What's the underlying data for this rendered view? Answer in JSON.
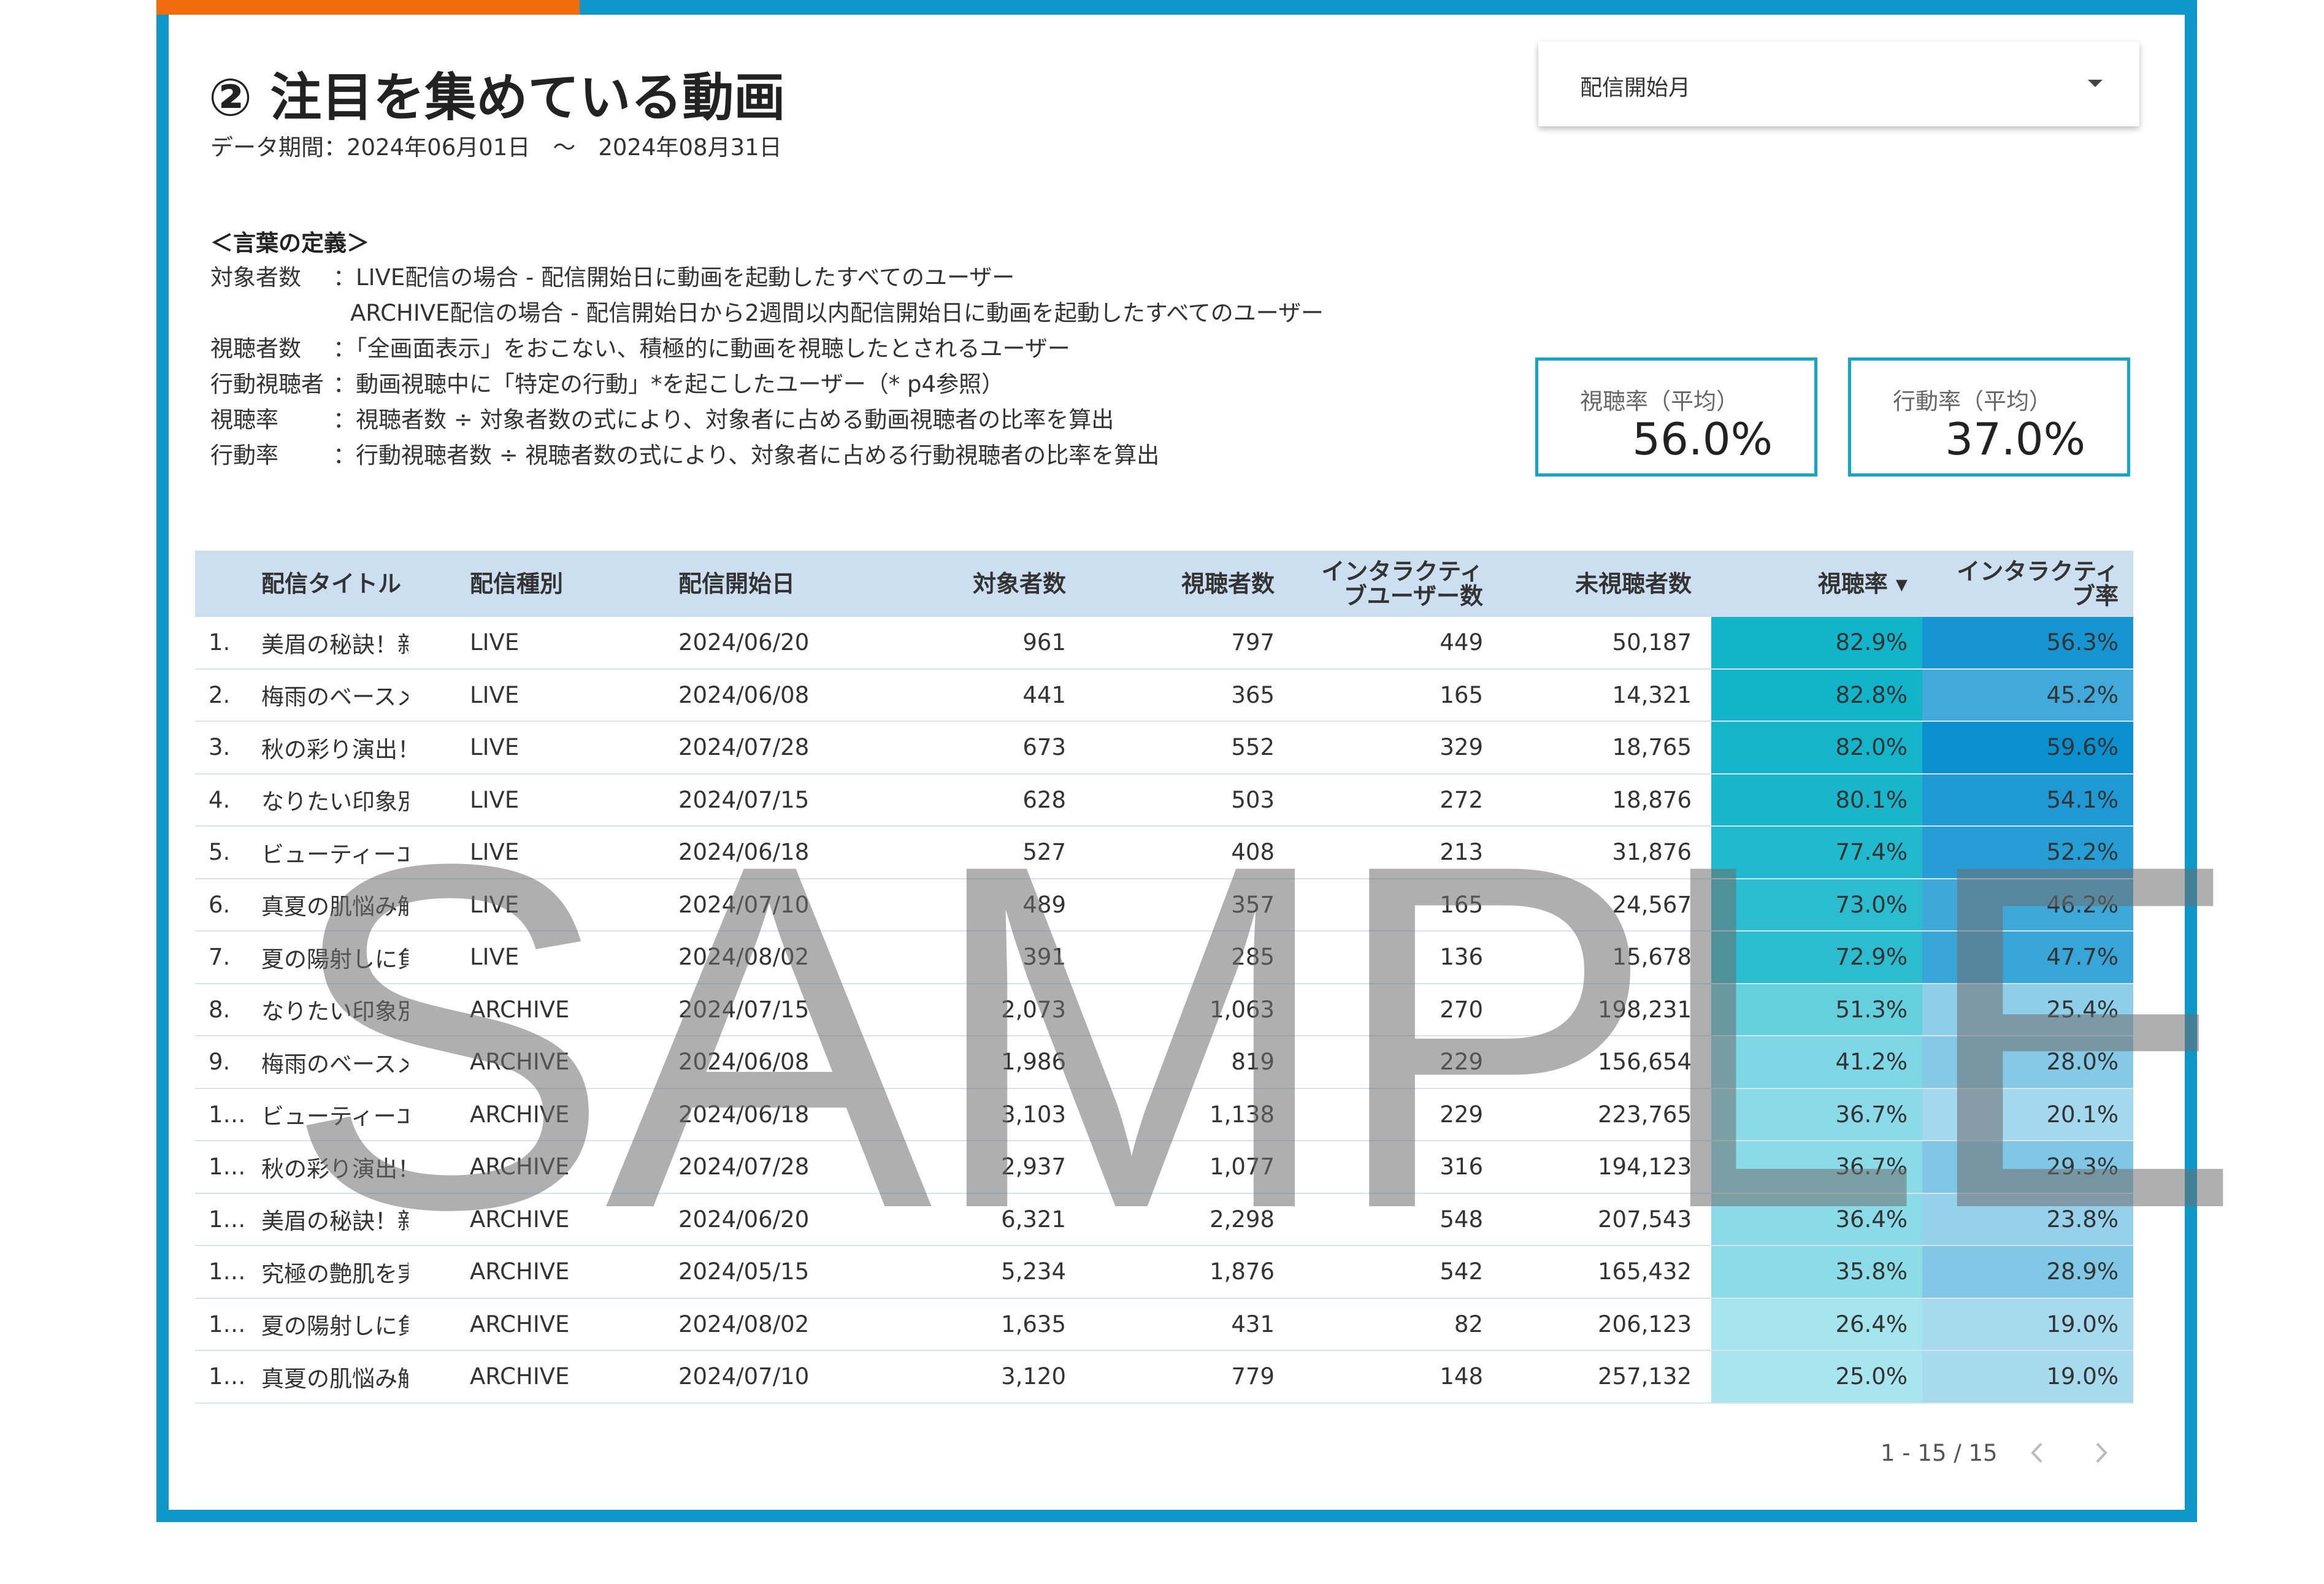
{
  "page": {
    "title": "② 注目を集めている動画",
    "period": "データ期間：2024年06月01日　～　2024年08月31日"
  },
  "filter": {
    "label": "配信開始月"
  },
  "definitions": {
    "heading": "＜言葉の定義＞",
    "rows": [
      {
        "term": "対象者数",
        "text": "：LIVE配信の場合 - 配信開始日に動画を起動したすべてのユーザー"
      },
      {
        "term": "",
        "text": "ARCHIVE配信の場合 - 配信開始日から2週間以内配信開始日に動画を起動したすべてのユーザー"
      },
      {
        "term": "視聴者数",
        "text": "：「全画面表示」をおこない、積極的に動画を視聴したとされるユーザー"
      },
      {
        "term": "行動視聴者",
        "text": "：動画視聴中に「特定の行動」*を起こしたユーザー（* p4参照）"
      },
      {
        "term": "視聴率",
        "text": "：視聴者数 ÷ 対象者数の式により、対象者に占める動画視聴者の比率を算出"
      },
      {
        "term": "行動率",
        "text": "：行動視聴者数 ÷ 視聴者数の式により、対象者に占める行動視聴者の比率を算出"
      }
    ]
  },
  "kpis": [
    {
      "label": "視聴率（平均）",
      "value": "56.0%"
    },
    {
      "label": "行動率（平均）",
      "value": "37.0%"
    }
  ],
  "table": {
    "columns": [
      "配信タイトル",
      "配信種別",
      "配信開始日",
      "対象者数",
      "視聴者数",
      "インタラクティ\nブユーザー数",
      "未視聴者数",
      "視聴率 ▾",
      "インタラクティ\nブ率"
    ],
    "rows": [
      {
        "idx": "1.",
        "title": "美眉の秘訣！新…",
        "type": "LIVE",
        "date": "2024/06/20",
        "target": "961",
        "viewers": "797",
        "interactive": "449",
        "unviewed": "50,187",
        "view_rate": "82.9%",
        "inter_rate": "56.3%"
      },
      {
        "idx": "2.",
        "title": "梅雨のベースメ…",
        "type": "LIVE",
        "date": "2024/06/08",
        "target": "441",
        "viewers": "365",
        "interactive": "165",
        "unviewed": "14,321",
        "view_rate": "82.8%",
        "inter_rate": "45.2%"
      },
      {
        "idx": "3.",
        "title": "秋の彩り演出！…",
        "type": "LIVE",
        "date": "2024/07/28",
        "target": "673",
        "viewers": "552",
        "interactive": "329",
        "unviewed": "18,765",
        "view_rate": "82.0%",
        "inter_rate": "59.6%"
      },
      {
        "idx": "4.",
        "title": "なりたい印象別…",
        "type": "LIVE",
        "date": "2024/07/15",
        "target": "628",
        "viewers": "503",
        "interactive": "272",
        "unviewed": "18,876",
        "view_rate": "80.1%",
        "inter_rate": "54.1%"
      },
      {
        "idx": "5.",
        "title": "ビューティーエ…",
        "type": "LIVE",
        "date": "2024/06/18",
        "target": "527",
        "viewers": "408",
        "interactive": "213",
        "unviewed": "31,876",
        "view_rate": "77.4%",
        "inter_rate": "52.2%"
      },
      {
        "idx": "6.",
        "title": "真夏の肌悩み解…",
        "type": "LIVE",
        "date": "2024/07/10",
        "target": "489",
        "viewers": "357",
        "interactive": "165",
        "unviewed": "24,567",
        "view_rate": "73.0%",
        "inter_rate": "46.2%"
      },
      {
        "idx": "7.",
        "title": "夏の陽射しに負…",
        "type": "LIVE",
        "date": "2024/08/02",
        "target": "391",
        "viewers": "285",
        "interactive": "136",
        "unviewed": "15,678",
        "view_rate": "72.9%",
        "inter_rate": "47.7%"
      },
      {
        "idx": "8.",
        "title": "なりたい印象別…",
        "type": "ARCHIVE",
        "date": "2024/07/15",
        "target": "2,073",
        "viewers": "1,063",
        "interactive": "270",
        "unviewed": "198,231",
        "view_rate": "51.3%",
        "inter_rate": "25.4%"
      },
      {
        "idx": "9.",
        "title": "梅雨のベースメ…",
        "type": "ARCHIVE",
        "date": "2024/06/08",
        "target": "1,986",
        "viewers": "819",
        "interactive": "229",
        "unviewed": "156,654",
        "view_rate": "41.2%",
        "inter_rate": "28.0%"
      },
      {
        "idx": "1…",
        "title": "ビューティーエ…",
        "type": "ARCHIVE",
        "date": "2024/06/18",
        "target": "3,103",
        "viewers": "1,138",
        "interactive": "229",
        "unviewed": "223,765",
        "view_rate": "36.7%",
        "inter_rate": "20.1%"
      },
      {
        "idx": "1…",
        "title": "秋の彩り演出！…",
        "type": "ARCHIVE",
        "date": "2024/07/28",
        "target": "2,937",
        "viewers": "1,077",
        "interactive": "316",
        "unviewed": "194,123",
        "view_rate": "36.7%",
        "inter_rate": "29.3%"
      },
      {
        "idx": "1…",
        "title": "美眉の秘訣！新…",
        "type": "ARCHIVE",
        "date": "2024/06/20",
        "target": "6,321",
        "viewers": "2,298",
        "interactive": "548",
        "unviewed": "207,543",
        "view_rate": "36.4%",
        "inter_rate": "23.8%"
      },
      {
        "idx": "1…",
        "title": "究極の艶肌を実…",
        "type": "ARCHIVE",
        "date": "2024/05/15",
        "target": "5,234",
        "viewers": "1,876",
        "interactive": "542",
        "unviewed": "165,432",
        "view_rate": "35.8%",
        "inter_rate": "28.9%"
      },
      {
        "idx": "1…",
        "title": "夏の陽射しに負…",
        "type": "ARCHIVE",
        "date": "2024/08/02",
        "target": "1,635",
        "viewers": "431",
        "interactive": "82",
        "unviewed": "206,123",
        "view_rate": "26.4%",
        "inter_rate": "19.0%"
      },
      {
        "idx": "1…",
        "title": "真夏の肌悩み解…",
        "type": "ARCHIVE",
        "date": "2024/07/10",
        "target": "3,120",
        "viewers": "779",
        "interactive": "148",
        "unviewed": "257,132",
        "view_rate": "25.0%",
        "inter_rate": "19.0%"
      }
    ]
  },
  "pagination": {
    "text": "1 - 15 / 15"
  },
  "watermark": "SAMPLE",
  "colors": {
    "frame": "#0e97c9",
    "accent": "#f26b0c",
    "header_bg": "#cbdff1",
    "kpi_border": "#14a5c7",
    "view_rate_heat": "#12b4c9",
    "inter_rate_heat": "#0a8fcf"
  },
  "icons": {
    "dropdown": "caret-down-icon",
    "prev": "chevron-left-icon",
    "next": "chevron-right-icon"
  }
}
